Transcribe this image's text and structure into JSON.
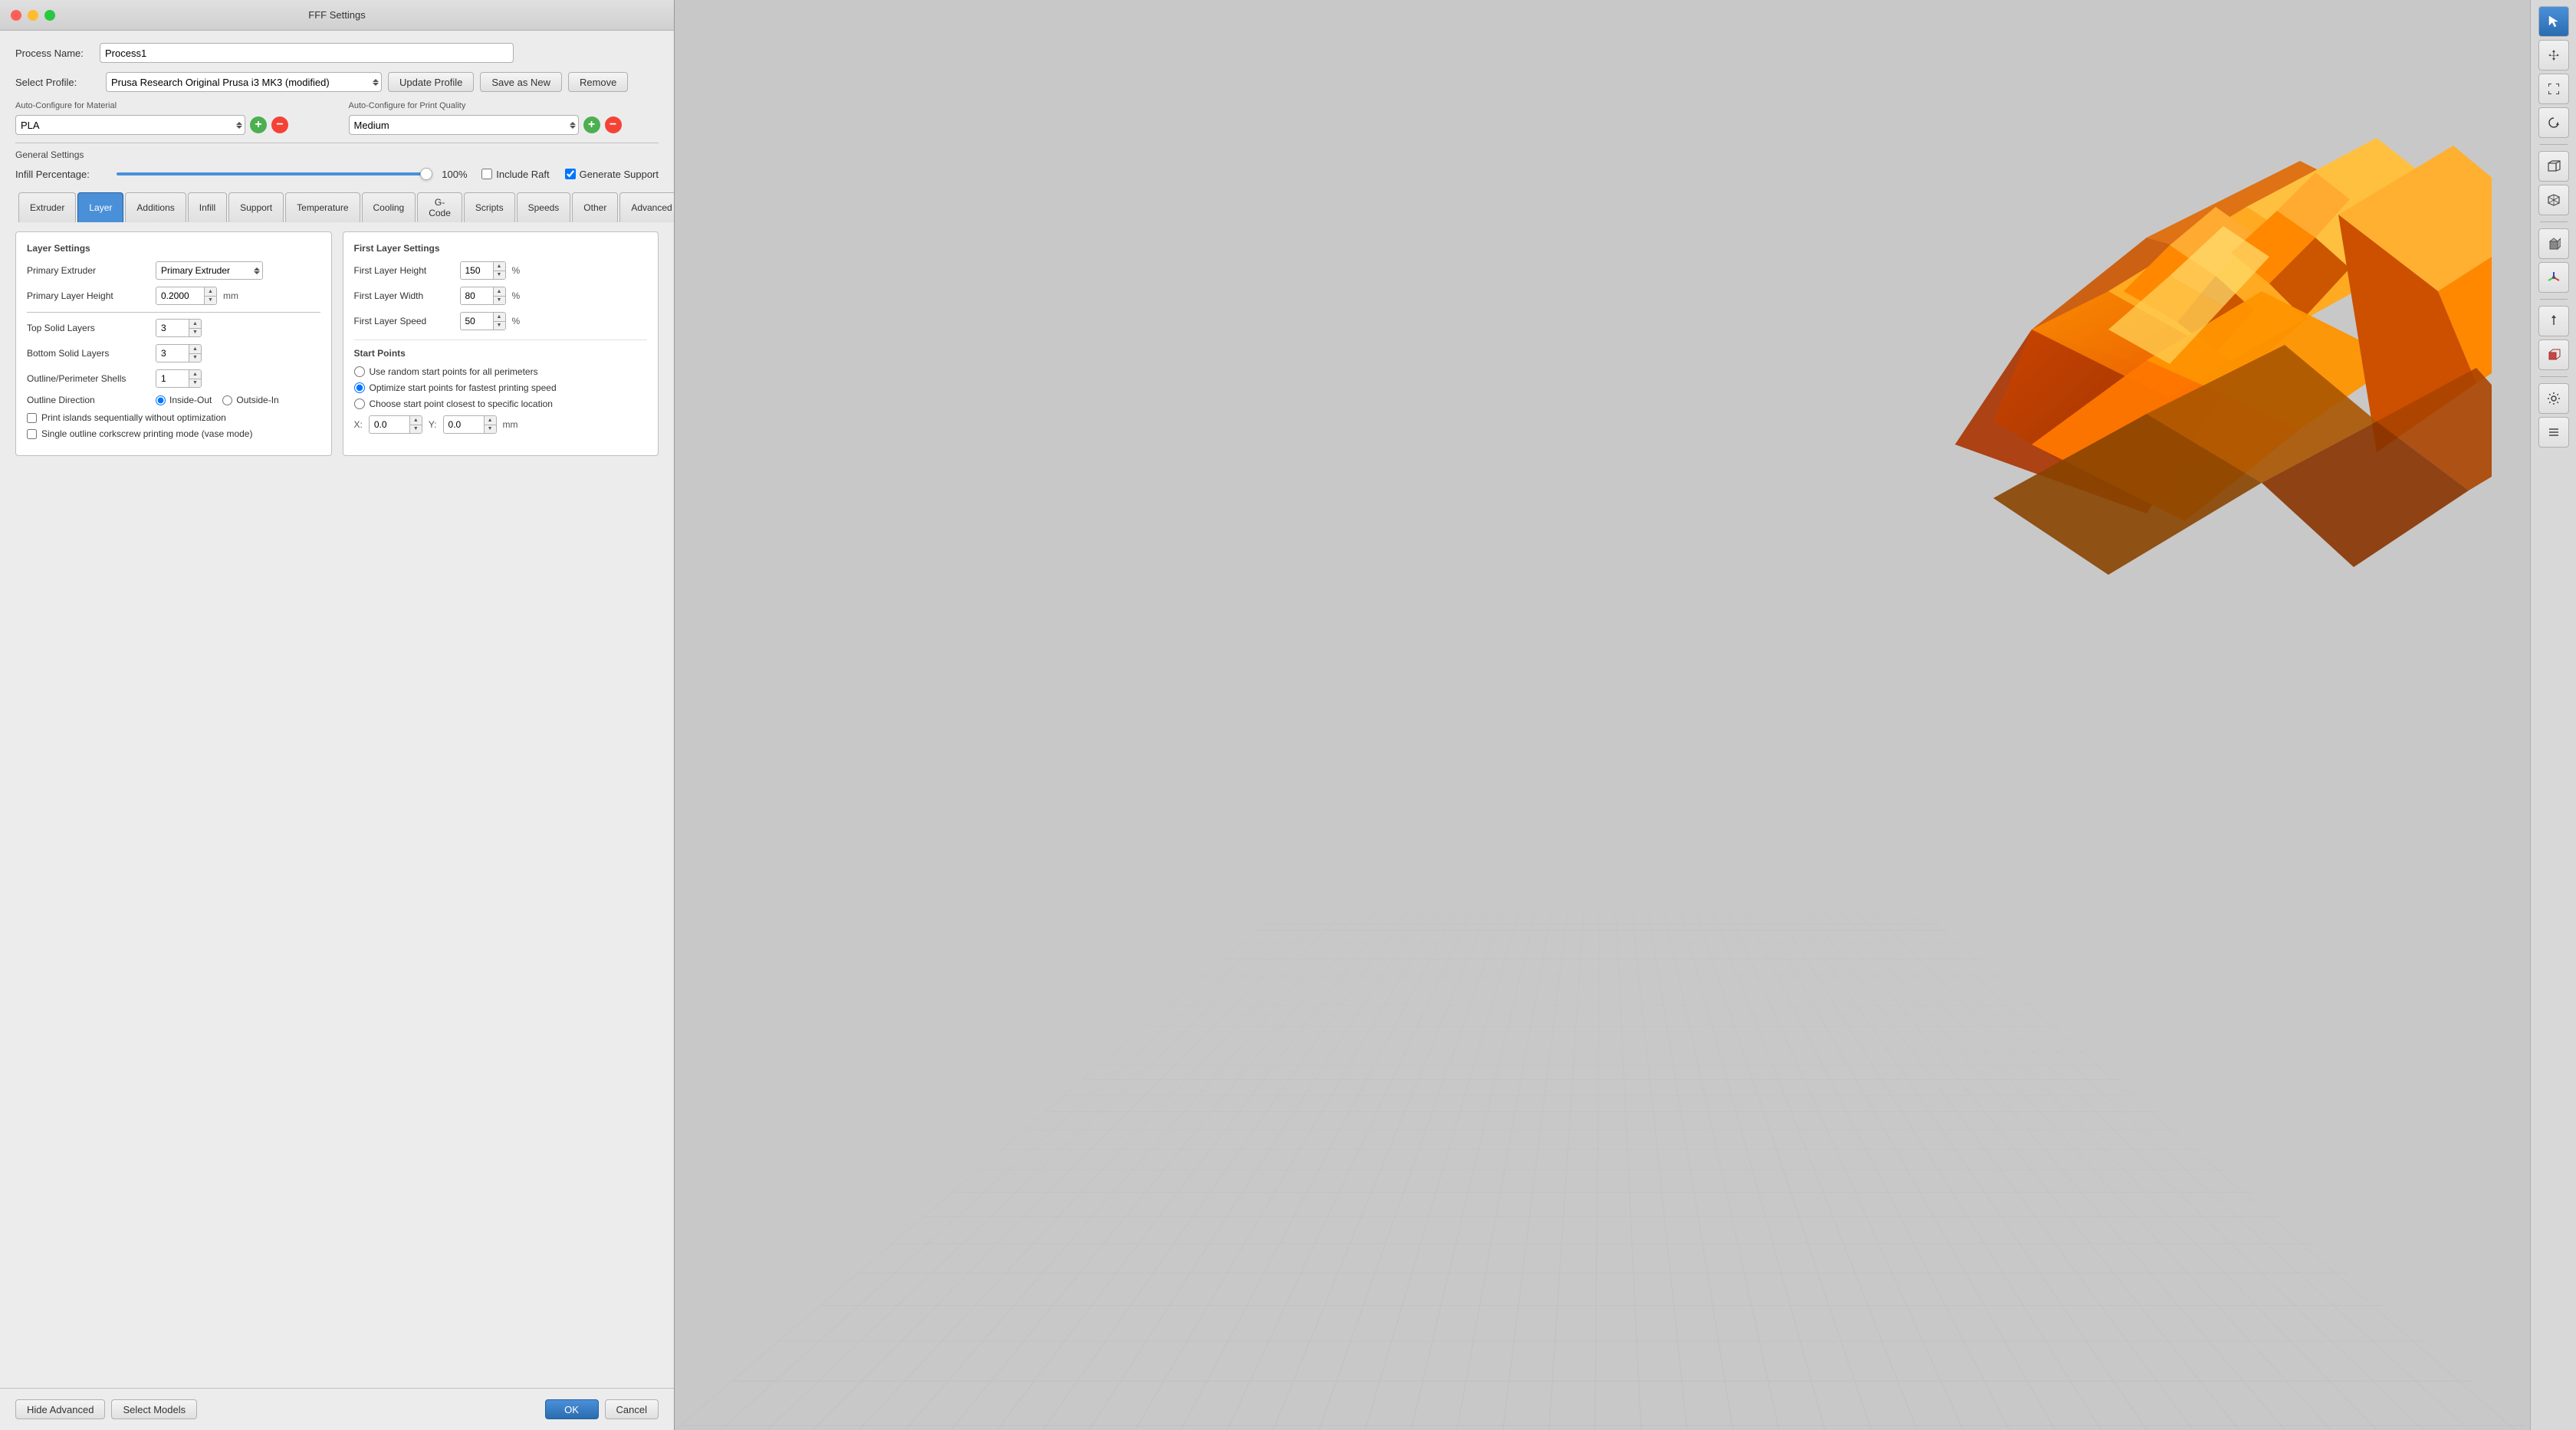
{
  "window": {
    "title": "FFF Settings"
  },
  "header": {
    "process_label": "Process Name:",
    "process_value": "Process1",
    "profile_label": "Select Profile:",
    "profile_value": "Prusa Research Original Prusa i3 MK3 (modified)",
    "update_profile_btn": "Update Profile",
    "save_as_new_btn": "Save as New",
    "remove_btn": "Remove"
  },
  "auto_configure": {
    "material_label": "Auto-Configure for Material",
    "material_value": "PLA",
    "quality_label": "Auto-Configure for Print Quality",
    "quality_value": "Medium"
  },
  "general_settings": {
    "label": "General Settings",
    "infill_label": "Infill Percentage:",
    "infill_value": "100",
    "infill_percent": "100%",
    "include_raft_label": "Include Raft",
    "generate_support_label": "Generate Support"
  },
  "tabs": [
    {
      "id": "extruder",
      "label": "Extruder",
      "active": false
    },
    {
      "id": "layer",
      "label": "Layer",
      "active": true
    },
    {
      "id": "additions",
      "label": "Additions",
      "active": false
    },
    {
      "id": "infill",
      "label": "Infill",
      "active": false
    },
    {
      "id": "support",
      "label": "Support",
      "active": false
    },
    {
      "id": "temperature",
      "label": "Temperature",
      "active": false
    },
    {
      "id": "cooling",
      "label": "Cooling",
      "active": false
    },
    {
      "id": "gcode",
      "label": "G-Code",
      "active": false
    },
    {
      "id": "scripts",
      "label": "Scripts",
      "active": false
    },
    {
      "id": "speeds",
      "label": "Speeds",
      "active": false
    },
    {
      "id": "other",
      "label": "Other",
      "active": false
    },
    {
      "id": "advanced",
      "label": "Advanced",
      "active": false
    }
  ],
  "layer_settings": {
    "panel_label": "Layer Settings",
    "primary_extruder_label": "Primary Extruder",
    "primary_extruder_value": "Primary Extruder",
    "primary_layer_height_label": "Primary Layer Height",
    "primary_layer_height_value": "0.2000",
    "primary_layer_height_unit": "mm",
    "top_solid_layers_label": "Top Solid Layers",
    "top_solid_layers_value": "3",
    "bottom_solid_layers_label": "Bottom Solid Layers",
    "bottom_solid_layers_value": "3",
    "outline_shells_label": "Outline/Perimeter Shells",
    "outline_shells_value": "1",
    "outline_direction_label": "Outline Direction",
    "inside_out_label": "Inside-Out",
    "outside_in_label": "Outside-In",
    "print_islands_label": "Print islands sequentially without optimization",
    "vase_mode_label": "Single outline corkscrew printing mode (vase mode)"
  },
  "first_layer_settings": {
    "panel_label": "First Layer Settings",
    "height_label": "First Layer Height",
    "height_value": "150",
    "height_unit": "%",
    "width_label": "First Layer Width",
    "width_value": "80",
    "width_unit": "%",
    "speed_label": "First Layer Speed",
    "speed_value": "50",
    "speed_unit": "%"
  },
  "start_points": {
    "section_label": "Start Points",
    "random_label": "Use random start points for all perimeters",
    "optimize_label": "Optimize start points for fastest printing speed",
    "specific_label": "Choose start point closest to specific location",
    "x_label": "X:",
    "x_value": "0.0",
    "y_label": "Y:",
    "y_value": "0.0",
    "coord_unit": "mm"
  },
  "bottom_bar": {
    "hide_advanced_btn": "Hide Advanced",
    "select_models_btn": "Select Models",
    "ok_btn": "OK",
    "cancel_btn": "Cancel"
  },
  "toolbar": {
    "icons": [
      {
        "id": "cursor",
        "symbol": "↖",
        "active": true
      },
      {
        "id": "move",
        "symbol": "✛"
      },
      {
        "id": "scale",
        "symbol": "⤢"
      },
      {
        "id": "rotate",
        "symbol": "↻"
      },
      {
        "id": "view3d",
        "symbol": "◻"
      },
      {
        "id": "perspective",
        "symbol": "⬡"
      },
      {
        "id": "viewcube",
        "symbol": "⬛"
      },
      {
        "id": "axis",
        "symbol": "⊕"
      },
      {
        "id": "move2",
        "symbol": "↑"
      },
      {
        "id": "solidview",
        "symbol": "◼"
      },
      {
        "id": "settings",
        "symbol": "⚙"
      },
      {
        "id": "layers",
        "symbol": "≡"
      }
    ]
  }
}
